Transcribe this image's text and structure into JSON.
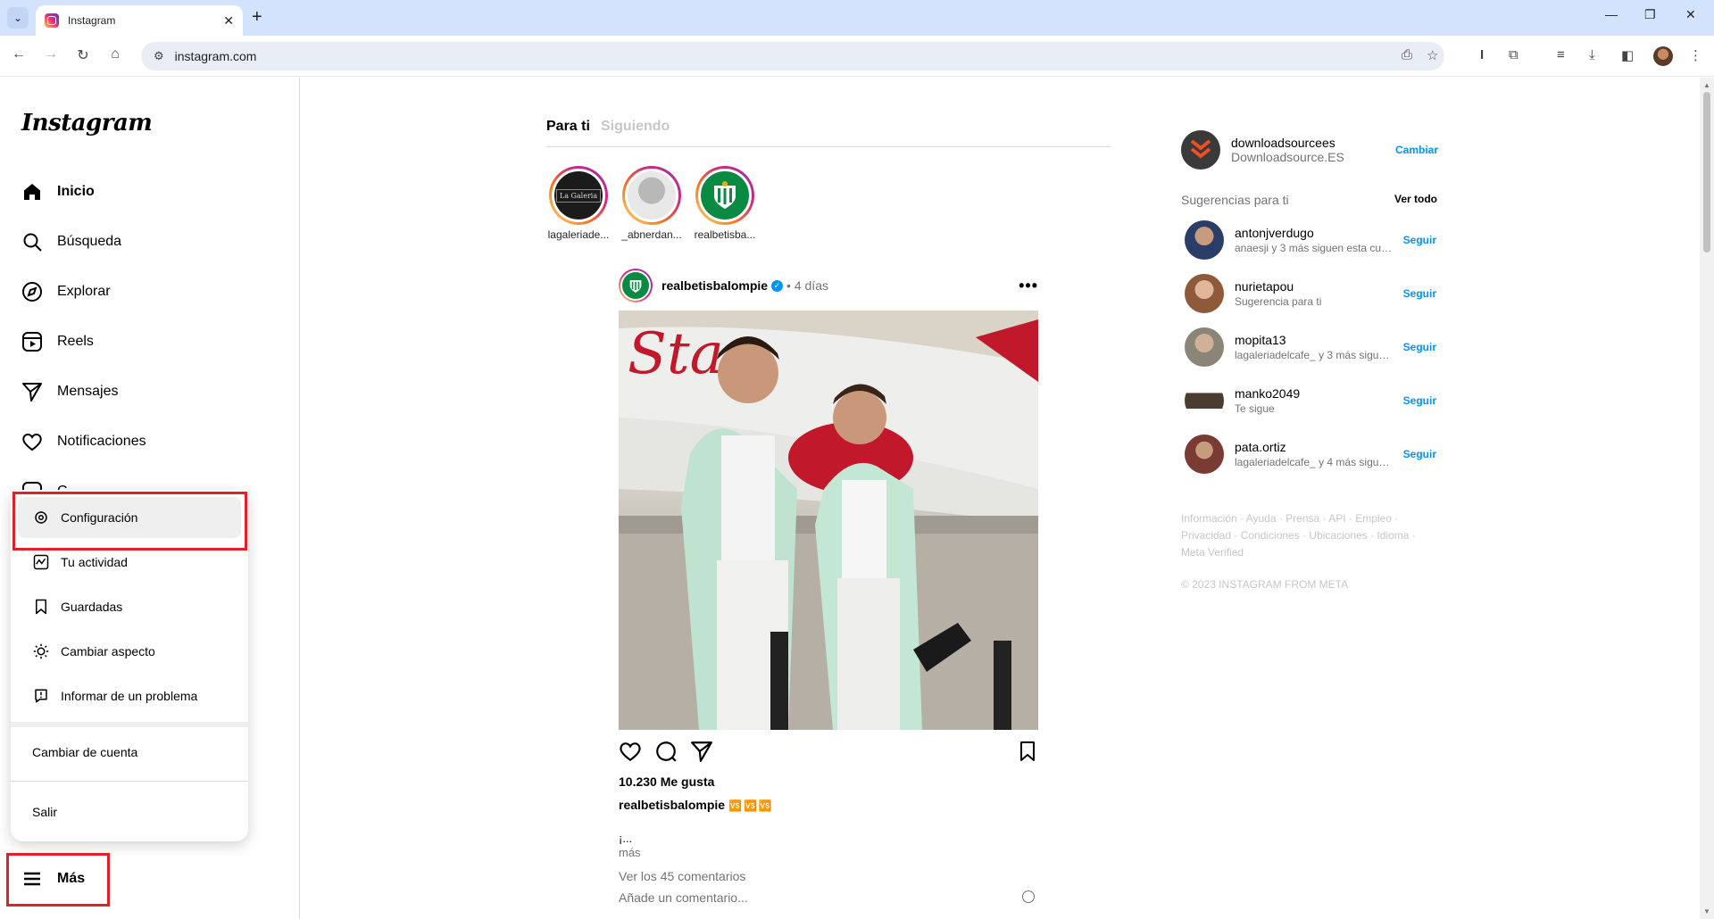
{
  "browser": {
    "tab_title": "Instagram",
    "url": "instagram.com"
  },
  "sidebar": {
    "logo": "Instagram",
    "items": [
      {
        "label": "Inicio",
        "icon": "home-icon"
      },
      {
        "label": "Búsqueda",
        "icon": "search-icon"
      },
      {
        "label": "Explorar",
        "icon": "compass-icon"
      },
      {
        "label": "Reels",
        "icon": "reels-icon"
      },
      {
        "label": "Mensajes",
        "icon": "send-icon"
      },
      {
        "label": "Notificaciones",
        "icon": "heart-icon"
      },
      {
        "label": "C",
        "icon": "create-icon"
      }
    ],
    "more_label": "Más"
  },
  "more_menu": {
    "items": [
      {
        "label": "Configuración",
        "icon": "gear-icon"
      },
      {
        "label": "Tu actividad",
        "icon": "activity-icon"
      },
      {
        "label": "Guardadas",
        "icon": "bookmark-icon"
      },
      {
        "label": "Cambiar aspecto",
        "icon": "sun-icon"
      },
      {
        "label": "Informar de un problema",
        "icon": "report-icon"
      }
    ],
    "switch_account": "Cambiar de cuenta",
    "logout": "Salir"
  },
  "feed": {
    "tabs": [
      "Para ti",
      "Siguiendo"
    ],
    "stories": [
      {
        "username": "lagaleriade..."
      },
      {
        "username": "_abnerdan..."
      },
      {
        "username": "realbetisba..."
      }
    ],
    "post": {
      "username": "realbetisbalompie",
      "time": "• 4 días",
      "likes": "10.230 Me gusta",
      "caption_user": "realbetisbalompie",
      "caption_emoji": "🆚🆚🆚",
      "caption_text": "¡...",
      "more": "más",
      "comments": "Ver los 45 comentarios",
      "add_comment": "Añade un comentario..."
    }
  },
  "right": {
    "me": {
      "username": "downloadsourcees",
      "name": "Downloadsource.ES",
      "switch": "Cambiar"
    },
    "suggestions_title": "Sugerencias para ti",
    "see_all": "Ver todo",
    "suggestions": [
      {
        "username": "antonjverdugo",
        "sub": "anaesji y 3 más siguen esta cue...",
        "follow": "Seguir",
        "color": "#2a3d66"
      },
      {
        "username": "nurietapou",
        "sub": "Sugerencia para ti",
        "follow": "Seguir",
        "color": "#b98a6d"
      },
      {
        "username": "mopita13",
        "sub": "lagaleriadelcafe_ y 3 más siguen...",
        "follow": "Seguir",
        "color": "#8a8577"
      },
      {
        "username": "manko2049",
        "sub": "Te sigue",
        "follow": "Seguir",
        "color": "#4a3c30"
      },
      {
        "username": "pata.ortiz",
        "sub": "lagaleriadelcafe_ y 4 más siguen...",
        "follow": "Seguir",
        "color": "#7a3b34"
      }
    ],
    "footer": "Información · Ayuda · Prensa · API · Empleo · Privacidad · Condiciones · Ubicaciones · Idioma · Meta Verified",
    "copyright": "© 2023 INSTAGRAM FROM META"
  },
  "colors": {
    "accent": "#0095f6",
    "highlight_border": "#e0202a"
  }
}
